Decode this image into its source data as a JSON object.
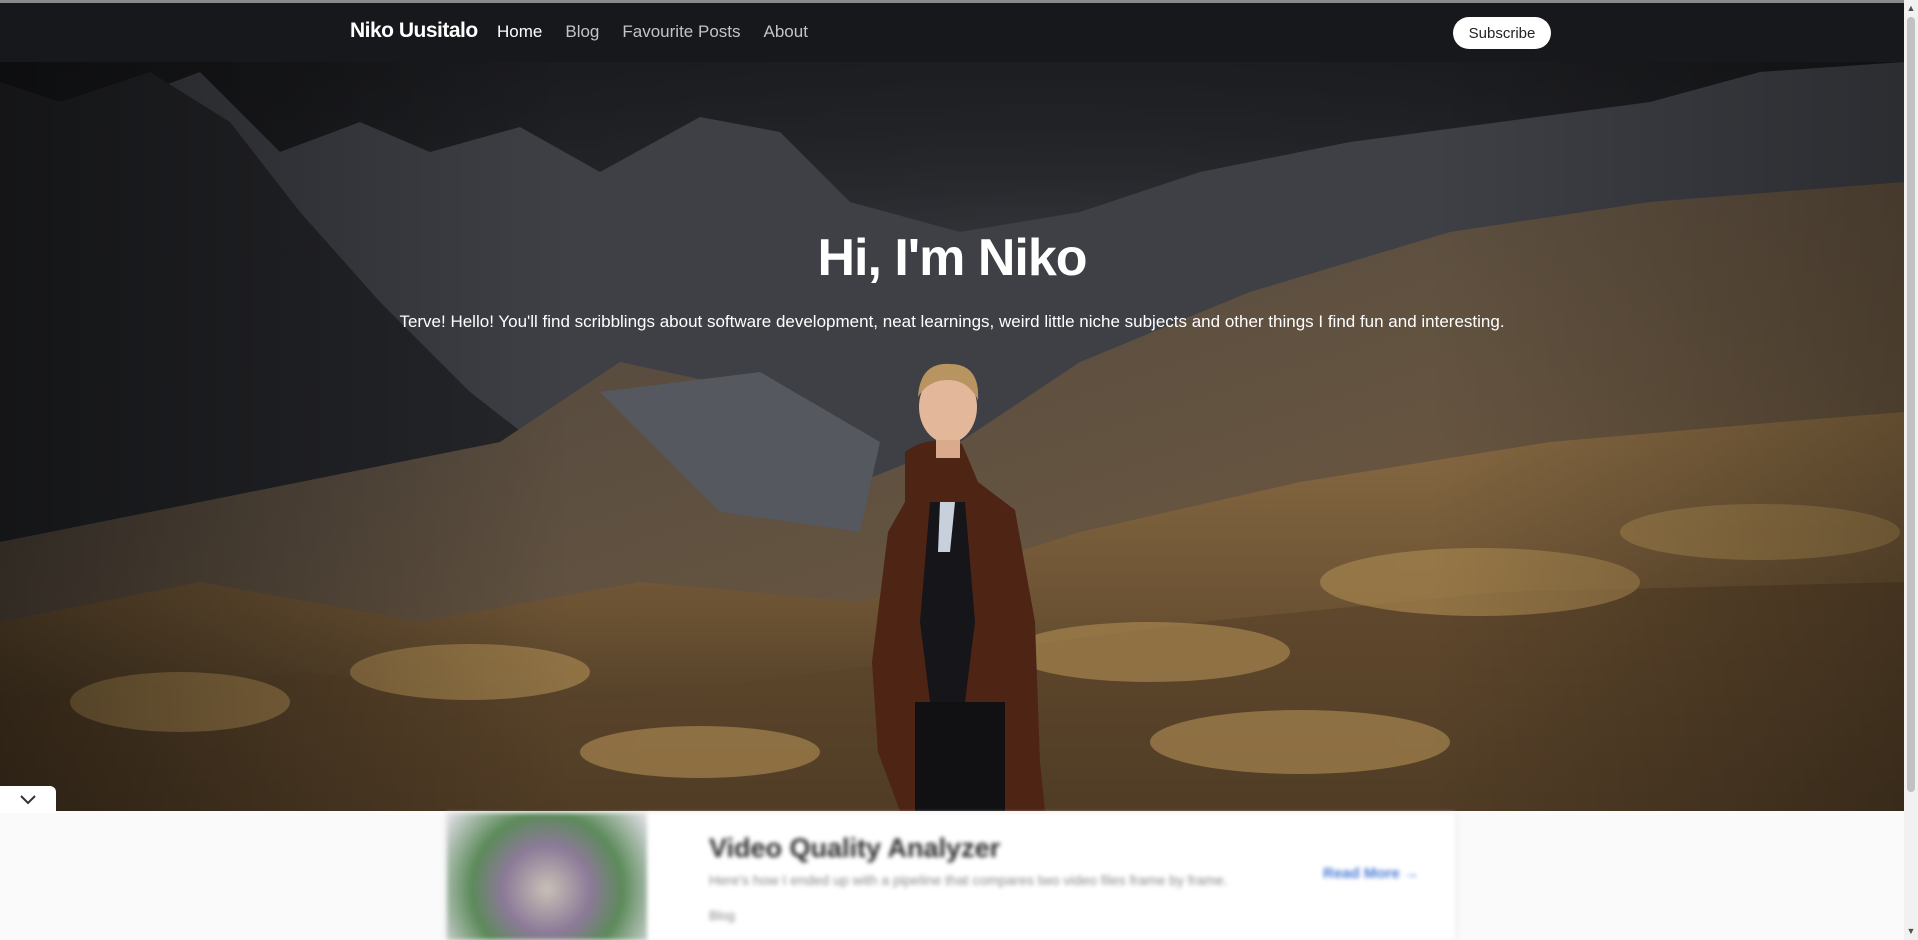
{
  "nav": {
    "brand": "Niko Uusitalo",
    "links": [
      {
        "label": "Home",
        "active": true
      },
      {
        "label": "Blog",
        "active": false
      },
      {
        "label": "Favourite Posts",
        "active": false
      },
      {
        "label": "About",
        "active": false
      }
    ],
    "subscribe_label": "Subscribe"
  },
  "hero": {
    "title": "Hi, I'm Niko",
    "subtitle": "Terve! Hello! You'll find scribblings about software development, neat learnings, weird little niche subjects and other things I find fun and interesting."
  },
  "featured_card": {
    "title": "Video Quality Analyzer",
    "excerpt": "Here's how I ended up with a pipeline that compares two video files frame by frame.",
    "meta": "Blog",
    "link_label": "Read More →"
  },
  "icons": {
    "collapse": "chevron-down-icon",
    "scroll_up": "triangle-up-icon",
    "scroll_down": "triangle-down-icon"
  },
  "colors": {
    "navbar_bg": "#17181b",
    "nav_active": "#ffffff",
    "nav_inactive": "#c4c4c4",
    "accent_link": "#4a7bd4"
  }
}
